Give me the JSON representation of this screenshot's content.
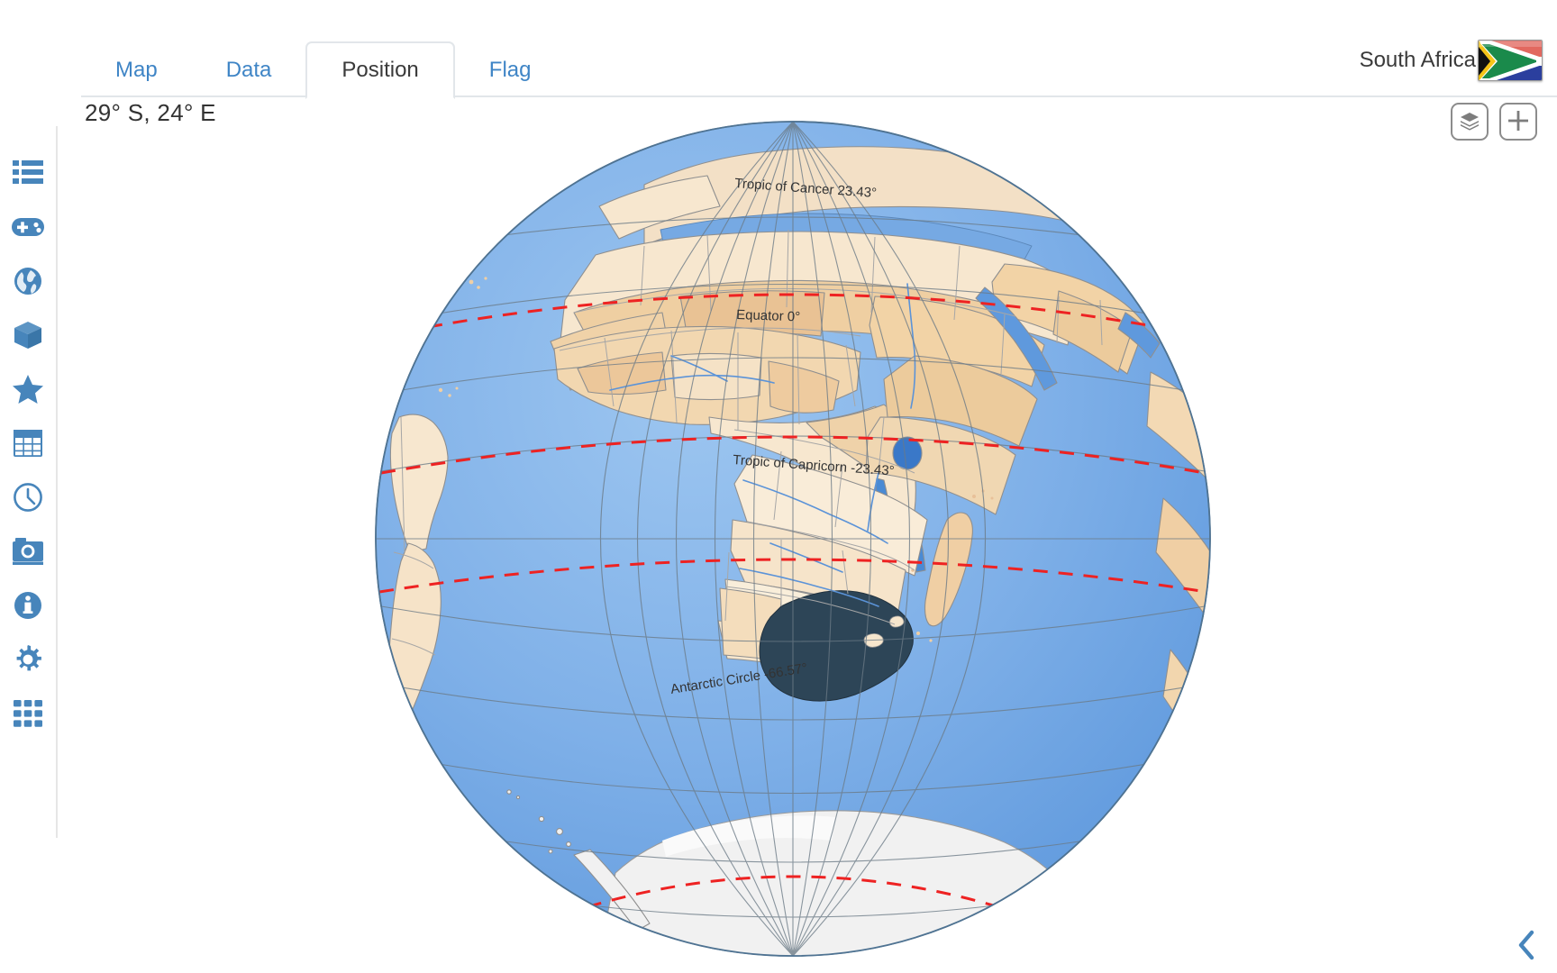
{
  "header": {
    "tabs": [
      {
        "label": "Map",
        "active": false
      },
      {
        "label": "Data",
        "active": false
      },
      {
        "label": "Position",
        "active": true
      },
      {
        "label": "Flag",
        "active": false
      }
    ],
    "country_label": "South Africa",
    "flag_name": "south-africa-flag"
  },
  "position": {
    "coordinates_text": "29° S, 24° E",
    "latitude": -29,
    "longitude": 24
  },
  "map_buttons": [
    {
      "name": "layers-button",
      "icon": "layers-icon"
    },
    {
      "name": "add-button",
      "icon": "plus-icon"
    }
  ],
  "sidebar": {
    "items": [
      {
        "name": "sidebar-item-list",
        "icon": "list-icon"
      },
      {
        "name": "sidebar-item-game",
        "icon": "gamepad-icon"
      },
      {
        "name": "sidebar-item-globe",
        "icon": "globe-icon"
      },
      {
        "name": "sidebar-item-3d",
        "icon": "cube-icon"
      },
      {
        "name": "sidebar-item-favorites",
        "icon": "star-icon"
      },
      {
        "name": "sidebar-item-table",
        "icon": "table-icon"
      },
      {
        "name": "sidebar-item-history",
        "icon": "clock-icon"
      },
      {
        "name": "sidebar-item-camera",
        "icon": "camera-icon"
      },
      {
        "name": "sidebar-item-info",
        "icon": "info-icon"
      },
      {
        "name": "sidebar-item-settings",
        "icon": "gear-icon"
      },
      {
        "name": "sidebar-item-apps",
        "icon": "grid-icon"
      }
    ]
  },
  "footer": {
    "collapse_icon": "chevron-left-icon"
  },
  "globe": {
    "highlighted_country": "South Africa",
    "projection": "orthographic",
    "center": {
      "lat": -29,
      "lon": 24
    },
    "graticule_step_degrees": 15,
    "latitude_lines": [
      {
        "label": "Tropic of Cancer 23.43°",
        "value": 23.43
      },
      {
        "label": "Equator 0°",
        "value": 0
      },
      {
        "label": "Tropic of Capricorn -23.43°",
        "value": -23.43
      },
      {
        "label": "Antarctic Circle -66.57°",
        "value": -66.57
      }
    ],
    "colors": {
      "ocean": "#76a9e3",
      "ocean_light": "#97c2ee",
      "land": "#f7e7cf",
      "land_alt": "#f0cfa4",
      "land_alt2": "#e8c199",
      "highlight": "#2d4557",
      "ice": "#f1f1f1",
      "border": "#9a9a9a",
      "graticule": "#6b7a86",
      "special_line": "#ee2222",
      "label": "#333333"
    }
  }
}
